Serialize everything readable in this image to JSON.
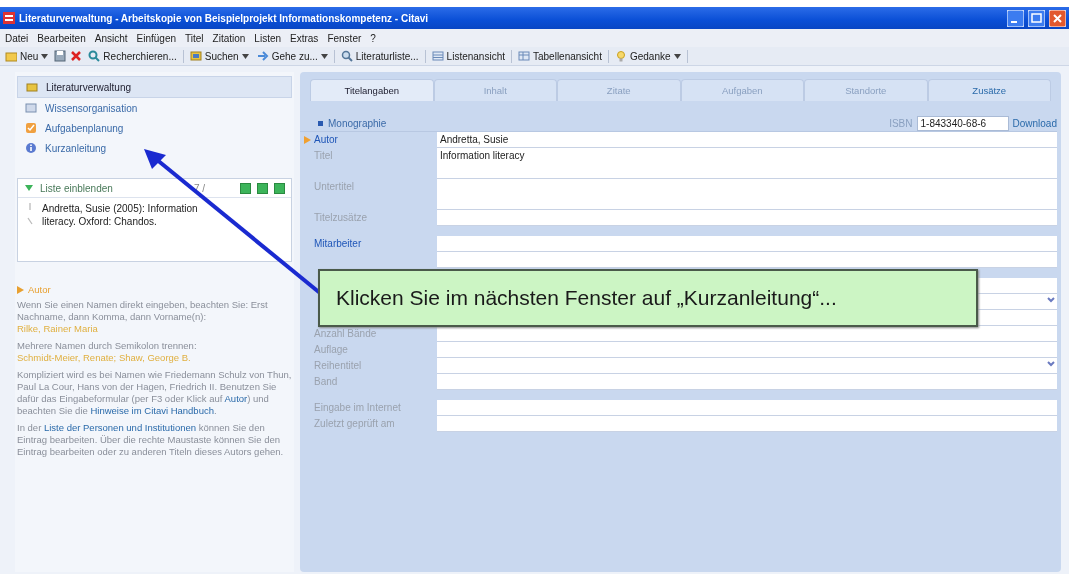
{
  "window": {
    "title": "Literaturverwaltung - Arbeitskopie von Beispielprojekt Informationskompetenz - Citavi"
  },
  "menu": [
    "Datei",
    "Bearbeiten",
    "Ansicht",
    "Einfügen",
    "Titel",
    "Zitation",
    "Listen",
    "Extras",
    "Fenster",
    "?"
  ],
  "toolbar": [
    {
      "kind": "dropdown",
      "label": "Neu"
    },
    {
      "kind": "icon"
    },
    {
      "kind": "icon"
    },
    {
      "kind": "button",
      "label": "Recherchieren..."
    },
    {
      "kind": "dropdown",
      "label": "Suchen"
    },
    {
      "kind": "dropdown",
      "label": "Gehe zu..."
    },
    {
      "kind": "button",
      "label": "Literaturliste..."
    },
    {
      "kind": "button",
      "label": "Listenansicht"
    },
    {
      "kind": "button",
      "label": "Tabellenansicht"
    },
    {
      "kind": "dropdown",
      "label": "Gedanke"
    }
  ],
  "nav": [
    {
      "label": "Literaturverwaltung",
      "selected": true
    },
    {
      "label": "Wissensorganisation",
      "selected": false
    },
    {
      "label": "Aufgabenplanung",
      "selected": false
    },
    {
      "label": "Kurzanleitung",
      "selected": false
    }
  ],
  "list_panel": {
    "toggle": "Liste einblenden",
    "count": "7 /",
    "entries": [
      "Andretta, Susie (2005): Information literacy. Oxford: Chandos."
    ]
  },
  "help": {
    "heading": "Autor",
    "paragraphs": [
      [
        {
          "kind": "text",
          "text": "Wenn Sie einen Namen direkt eingeben, beachten Sie: Erst Nachname, dann Komma, dann Vorname(n):"
        },
        {
          "kind": "example",
          "text": "Rilke, Rainer Maria"
        }
      ],
      [
        {
          "kind": "text",
          "text": "Mehrere Namen durch Semikolon trennen:"
        },
        {
          "kind": "example",
          "text": "Schmidt-Meier, Renate; Shaw, George B."
        }
      ],
      [
        {
          "kind": "text",
          "text": "Kompliziert wird es bei Namen wie Friedemann Schulz von Thun, Paul La Cour, Hans von der Hagen, Friedrich II. Benutzen Sie dafür das Eingabeformular (per F3 oder Klick auf "
        },
        {
          "kind": "link",
          "text": "Autor"
        },
        {
          "kind": "text",
          "text": ") und beachten Sie die "
        },
        {
          "kind": "link",
          "text": "Hinweise im Citavi Handbuch"
        },
        {
          "kind": "text",
          "text": "."
        }
      ],
      [
        {
          "kind": "text",
          "text": "In der "
        },
        {
          "kind": "link",
          "text": "Liste der Personen und Institutionen"
        },
        {
          "kind": "text",
          "text": " können Sie den Eintrag bearbeiten. Über die rechte Maustaste können Sie den Eintrag bearbeiten oder zu anderen Titeln dieses Autors gehen."
        }
      ]
    ]
  },
  "tabs": [
    {
      "label": "Titelangaben",
      "selected": true
    },
    {
      "label": "Inhalt",
      "selected": false
    },
    {
      "label": "Zitate",
      "selected": false
    },
    {
      "label": "Aufgaben",
      "selected": false
    },
    {
      "label": "Standorte",
      "selected": false
    },
    {
      "label": "Zusätze",
      "selected": false
    }
  ],
  "form": {
    "type": "Monographie",
    "isbn_label": "ISBN",
    "isbn": "1-843340-68-6",
    "download": "Download",
    "groups": [
      [
        {
          "label": "Autor",
          "value": "Andretta, Susie",
          "kind": "field",
          "linked": true,
          "current": true
        },
        {
          "label": "Titel",
          "value": "Information literacy",
          "kind": "tall",
          "linked": false,
          "current": false
        },
        {
          "label": "Untertitel",
          "kind": "tall",
          "linked": false,
          "current": false
        },
        {
          "label": "Titelzusätze",
          "kind": "field",
          "linked": false,
          "current": false
        }
      ],
      [
        {
          "label": "Mitarbeiter",
          "kind": "field",
          "linked": true,
          "current": false
        },
        {
          "kind": "field",
          "current": false
        }
      ],
      [
        {
          "kind": "field",
          "current": false
        },
        {
          "kind": "dropdown",
          "current": false
        },
        {
          "kind": "field",
          "current": false
        },
        {
          "label": "Anzahl Bände",
          "kind": "field",
          "linked": false,
          "current": false
        },
        {
          "label": "Auflage",
          "kind": "field",
          "linked": false,
          "current": false
        },
        {
          "label": "Reihentitel",
          "kind": "dropdown",
          "linked": false,
          "current": false
        },
        {
          "label": "Band",
          "kind": "field",
          "linked": false,
          "current": false
        }
      ],
      [
        {
          "label": "Eingabe im Internet",
          "kind": "field",
          "linked": false,
          "current": false
        },
        {
          "label": "Zuletzt geprüft am",
          "kind": "field",
          "linked": false,
          "current": false
        }
      ]
    ]
  },
  "callout": "Klicken Sie im nächsten Fenster auf „Kurzanleitung“..."
}
